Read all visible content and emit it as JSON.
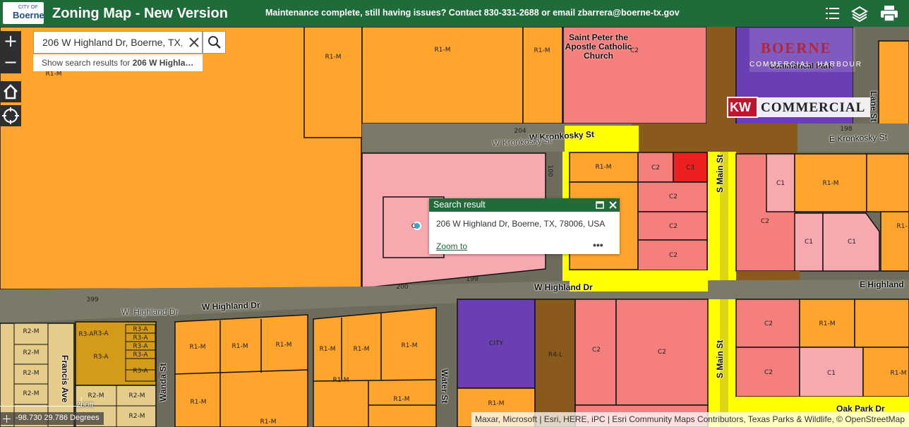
{
  "header": {
    "logo_small": "CITY OF",
    "logo_text": "Boerne",
    "title": "Zoning Map - New Version",
    "maintenance_notice": "Maintenance complete, still having issues? Contact 830-331-2688 or email zbarrera@boerne-tx.gov",
    "tools": [
      {
        "name": "legend-list-icon"
      },
      {
        "name": "layers-icon"
      },
      {
        "name": "print-icon"
      }
    ]
  },
  "map_controls": {
    "zoom_in": "+",
    "zoom_out": "−",
    "home_icon": "home-icon",
    "locate_icon": "locate-icon"
  },
  "search": {
    "value": "206 W Highland Dr, Boerne, TX, 78006, USA",
    "suggestion_prefix": "Show search results for ",
    "suggestion_term": "206 W Highla…"
  },
  "popup": {
    "title": "Search result",
    "address": "206 W Highland Dr, Boerne, TX, 78006, USA",
    "zoom_link": "Zoom to",
    "more": "•••"
  },
  "zones": [
    {
      "code": "R1-M"
    },
    {
      "code": "R1-M"
    },
    {
      "code": "R1-M"
    },
    {
      "code": "R1-M"
    },
    {
      "code": "C2"
    },
    {
      "code": "R1-M"
    },
    {
      "code": "C2"
    },
    {
      "code": "C3"
    },
    {
      "code": "C2"
    },
    {
      "code": "C2"
    },
    {
      "code": "C2"
    },
    {
      "code": "C1"
    },
    {
      "code": "R1-M"
    },
    {
      "code": "C2"
    },
    {
      "code": "C1"
    },
    {
      "code": "C1"
    },
    {
      "code": "R1-"
    },
    {
      "code": "R2-M"
    },
    {
      "code": "R2-M"
    },
    {
      "code": "R2-M"
    },
    {
      "code": "R2-M"
    },
    {
      "code": "R3-A"
    },
    {
      "code": "R3-A"
    },
    {
      "code": "R3-A"
    },
    {
      "code": "R3-A"
    },
    {
      "code": "R3-A"
    },
    {
      "code": "R3-A"
    },
    {
      "code": "R3-A"
    },
    {
      "code": "R3-A"
    },
    {
      "code": "R2-M"
    },
    {
      "code": "R2-M"
    },
    {
      "code": "R1-M"
    },
    {
      "code": "R1-M"
    },
    {
      "code": "R1-M"
    },
    {
      "code": "R1-M"
    },
    {
      "code": "R1-M"
    },
    {
      "code": "R1-M"
    },
    {
      "code": "R1-M"
    },
    {
      "code": "R1-M"
    },
    {
      "code": "R1-M"
    },
    {
      "code": "CITY"
    },
    {
      "code": "R4-L"
    },
    {
      "code": "C2"
    },
    {
      "code": "C2"
    },
    {
      "code": "R1-M"
    },
    {
      "code": "C2"
    },
    {
      "code": "R1-M"
    },
    {
      "code": "C2"
    },
    {
      "code": "C1"
    },
    {
      "code": "R1-M"
    },
    {
      "code": "R2-M"
    },
    {
      "code": "R1-M"
    },
    {
      "code": "C"
    }
  ],
  "streets": [
    {
      "label": "W Kronkosky St"
    },
    {
      "label": "W  Kronkosky St"
    },
    {
      "label": "E Kronkosky St"
    },
    {
      "label": "W Highland Dr"
    },
    {
      "label": "W Highland Dr"
    },
    {
      "label": "W. Highland  Dr"
    },
    {
      "label": "E Highland"
    },
    {
      "label": "S Main St"
    },
    {
      "label": "S Main St"
    },
    {
      "label": "Wanda St"
    },
    {
      "label": "Francis Ave"
    },
    {
      "label": "Water St"
    },
    {
      "label": "Oak Park Dr"
    },
    {
      "label": "Lane St"
    }
  ],
  "address_numbers": [
    "204",
    "100",
    "198",
    "200",
    "199",
    "399"
  ],
  "pois": [
    {
      "label": "Saint Peter the Apostle Catholic Church"
    },
    {
      "label": "Commerical Park"
    }
  ],
  "signage": {
    "kw": "KW",
    "commercial": "COMMERCIAL",
    "boerne": "BOERNE",
    "commercial_sub": "COMMERCIAL",
    "harbour": "HARBOUR"
  },
  "coordinates": "-98.730 29.786 Degrees",
  "scale": "200ft",
  "attribution": "Maxar, Microsoft | Esri, HERE, iPC | Esri Community Maps Contributors, Texas Parks & Wildlife, © OpenStreetMap",
  "colors": {
    "header_green": "#1f6b3a",
    "r1m_orange": "#ffa52e",
    "c2_salmon": "#f47f7d",
    "c1_pink": "#f7a9b0",
    "c3_red": "#ee1f1f",
    "city_purple": "#6a3fb4",
    "r4l_brown": "#8a5a1d",
    "r2m_tan": "#e5cc8a",
    "r3a_gold": "#d49b18",
    "main_st_yellow": "#ffff00"
  }
}
